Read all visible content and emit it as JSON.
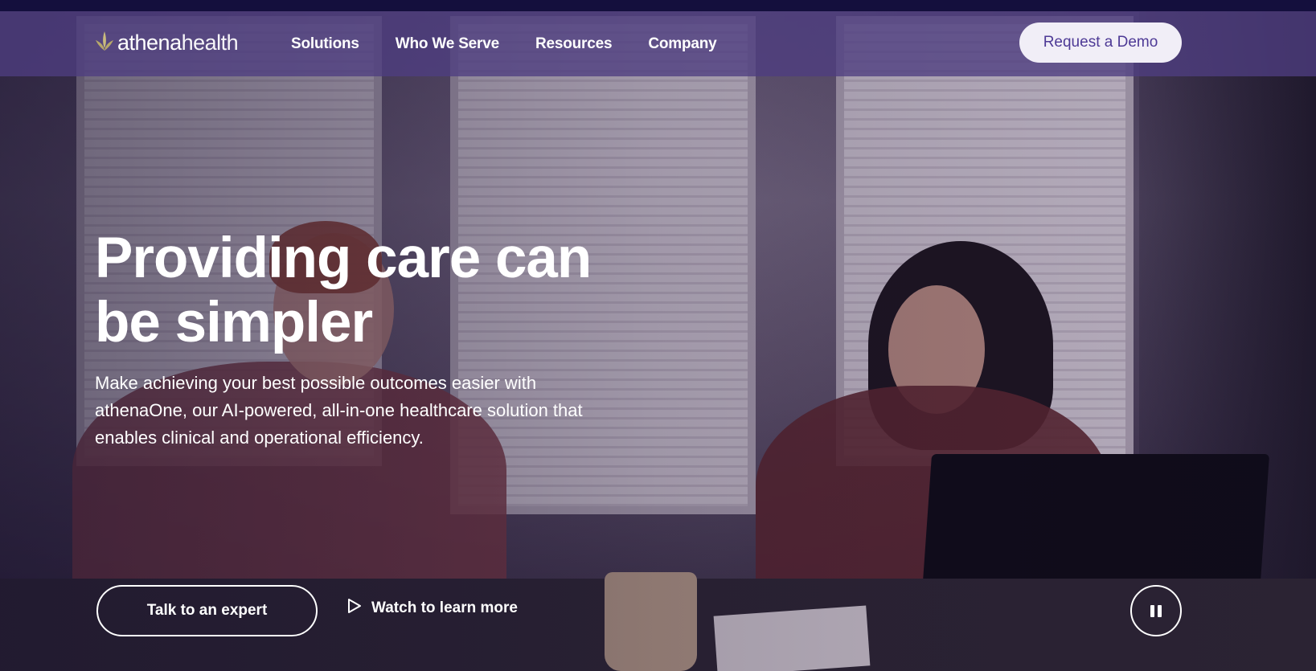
{
  "brand": {
    "logo_bold": "athena",
    "logo_light": "health",
    "icon": "leaf-logo-icon",
    "accent_color": "#4e3a96"
  },
  "nav": {
    "items": [
      {
        "label": "Solutions"
      },
      {
        "label": "Who We Serve"
      },
      {
        "label": "Resources"
      },
      {
        "label": "Company"
      }
    ],
    "cta_label": "Request a Demo"
  },
  "hero": {
    "title": "Providing care can be simpler",
    "subtitle": "Make achieving your best possible outcomes easier with athenaOne, our AI-powered, all-in-one healthcare solution that enables clinical and operational efficiency.",
    "primary_cta": "Talk to an expert",
    "secondary_cta": "Watch to learn more",
    "secondary_icon": "play-icon",
    "video_control_icon": "pause-icon"
  }
}
